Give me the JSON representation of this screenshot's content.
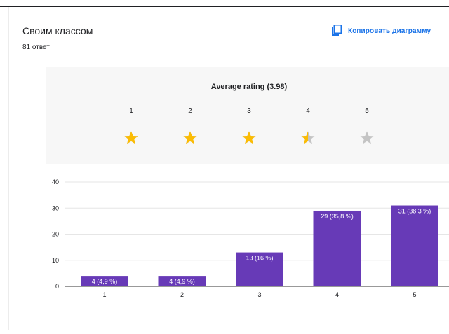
{
  "question": {
    "title": "Своим классом",
    "response_count": "81 ответ",
    "copy_label": "Копировать диаграмму"
  },
  "rating": {
    "title": "Average rating (3.98)",
    "average": 3.98,
    "max": 5,
    "labels": [
      "1",
      "2",
      "3",
      "4",
      "5"
    ]
  },
  "colors": {
    "bar": "#673ab7",
    "star_filled": "#fbbc04",
    "star_empty": "#c4c4c4",
    "link": "#1a73e8"
  },
  "icons": {
    "copy": "copy-icon",
    "star": "star-icon"
  },
  "chart_data": {
    "type": "bar",
    "categories": [
      "1",
      "2",
      "3",
      "4",
      "5"
    ],
    "values": [
      4,
      4,
      13,
      29,
      31
    ],
    "data_labels": [
      "4 (4,9 %)",
      "4 (4,9 %)",
      "13 (16 %)",
      "29 (35,8 %)",
      "31 (38,3 %)"
    ],
    "ylim": [
      0,
      40
    ],
    "yticks": [
      0,
      10,
      20,
      30,
      40
    ],
    "grid": true
  }
}
